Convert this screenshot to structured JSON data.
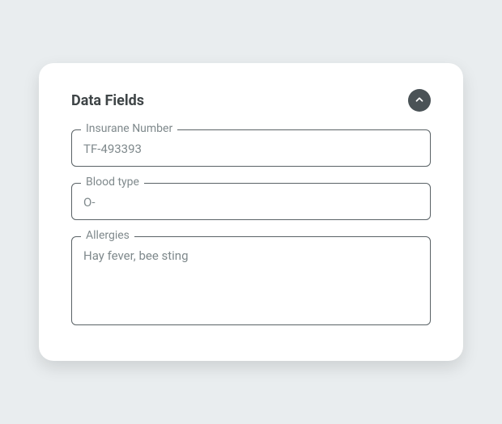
{
  "card": {
    "title": "Data Fields"
  },
  "fields": {
    "insurance": {
      "label": "Insurane Number",
      "value": "TF-493393"
    },
    "blood_type": {
      "label": "Blood type",
      "value": "O-"
    },
    "allergies": {
      "label": "Allergies",
      "value": "Hay fever, bee sting"
    }
  },
  "colors": {
    "background": "#e9edef",
    "card_bg": "#ffffff",
    "title": "#3f4547",
    "button_bg": "#4a5256",
    "border": "#5a6266",
    "text_muted": "#7f898c"
  }
}
